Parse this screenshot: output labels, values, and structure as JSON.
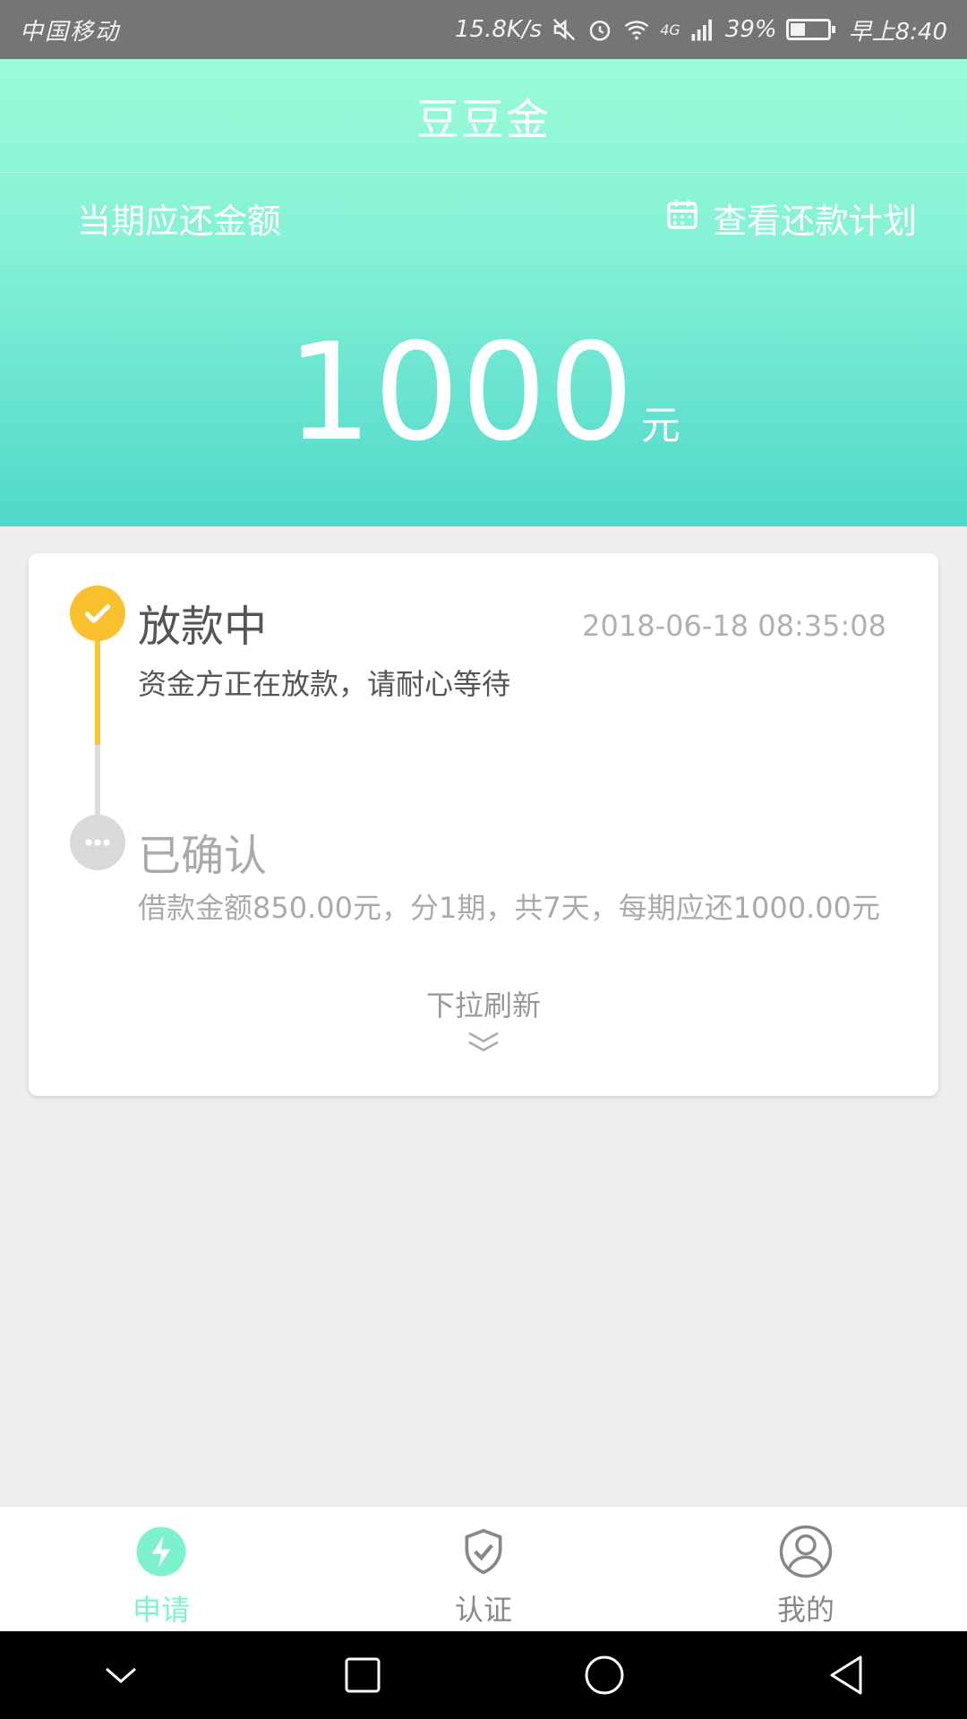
{
  "status_bar": {
    "carrier": "中国移动",
    "speed": "15.8K/s",
    "network": "4G",
    "battery": "39%",
    "time": "早上8:40"
  },
  "header": {
    "app_title": "豆豆金",
    "due_label": "当期应还金额",
    "plan_link": "查看还款计划",
    "amount": "1000",
    "amount_unit": "元"
  },
  "timeline": {
    "steps": [
      {
        "title": "放款中",
        "time": "2018-06-18 08:35:08",
        "description": "资金方正在放款，请耐心等待",
        "status": "done"
      },
      {
        "title": "已确认",
        "description": "借款金额850.00元，分1期，共7天，每期应还1000.00元",
        "status": "pending"
      }
    ],
    "pull_refresh": "下拉刷新"
  },
  "bottom_nav": {
    "items": [
      {
        "label": "申请",
        "icon": "lightning-icon",
        "active": true
      },
      {
        "label": "认证",
        "icon": "shield-check-icon",
        "active": false
      },
      {
        "label": "我的",
        "icon": "user-icon",
        "active": false
      }
    ]
  },
  "colors": {
    "accent": "#7ef2cf",
    "header_top": "#99fbd9",
    "header_bottom": "#4fd8c9",
    "step_done": "#fbc02d",
    "step_pending": "#d9d9d9"
  }
}
